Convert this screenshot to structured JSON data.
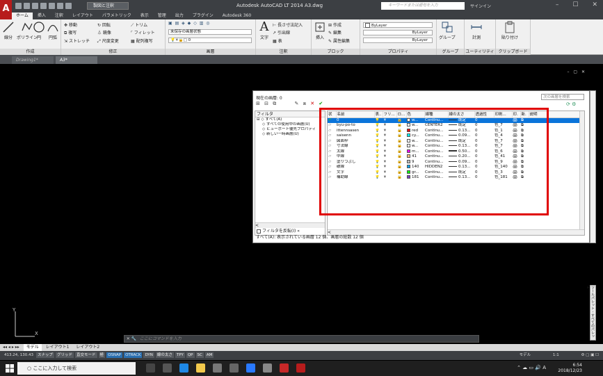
{
  "window": {
    "app_title": "Autodesk AutoCAD LT 2014   A3.dwg",
    "workspace": "製図と注釈",
    "search_placeholder": "キーワードまたは語句を入力",
    "signin": "サインイン",
    "filename": "A3.dwg"
  },
  "ribbon_tabs": [
    "ホーム",
    "挿入",
    "注釈",
    "レイアウト",
    "パラメトリック",
    "表示",
    "管理",
    "出力",
    "プラグイン",
    "Autodesk 360"
  ],
  "ribbon": {
    "groups": {
      "draw": "作成",
      "modify": "修正",
      "layer": "画層",
      "annotation": "注釈",
      "block": "ブロック",
      "properties": "プロパティ",
      "group": "グループ",
      "utility": "ユーティリティ",
      "clipboard": "クリップボード"
    },
    "draw_buttons": [
      "線分",
      "ポリライン",
      "円",
      "円弧"
    ],
    "modify_items": [
      "移動",
      "回転",
      "トリム",
      "複写",
      "鏡像",
      "フィレット",
      "ストレッチ",
      "尺度変更",
      "配列複写"
    ],
    "layer_state": "未保存の画層状態",
    "layer_current": "0",
    "text_button": "文字",
    "annotation_items": [
      "長さ寸法記入",
      "引出線",
      "表"
    ],
    "block_items": [
      "挿入",
      "作成",
      "編集",
      "属性編集"
    ],
    "bylayer_color": "ByLayer",
    "bylayer_linetype": "ByLayer",
    "bylayer_lineweight": "ByLayer",
    "group_button": "グループ",
    "measure_button": "計測",
    "paste_button": "貼り付け"
  },
  "file_tabs": [
    "Drawing1*",
    "A3*"
  ],
  "layer_manager": {
    "current_layer": "現在の画層: 0",
    "search_placeholder": "次の画層を検索",
    "filter_header": "フィルタ",
    "tree": [
      "すべて(A)",
      "すべての使用中の画層(U)",
      "ビューポート優先プロパティ",
      "新しい一時画層(U)"
    ],
    "invert_filter": "フィルタを反転(I)",
    "status": "すべて(A): 表示されている画層 12 個、画層の総数 12 個",
    "columns": [
      "状",
      "名前",
      "表..",
      "フリ...",
      "ロ...",
      "色",
      "線種",
      "線の太さ",
      "透過性",
      "印刷...",
      "印.",
      "新.",
      "説明"
    ],
    "rows": [
      {
        "name": "0",
        "color": "w...",
        "swatch": "#ffffff",
        "linetype": "Continu...",
        "lw": "既定",
        "trans": "0",
        "plot": "",
        "selected": true
      },
      {
        "name": "byu-po-to",
        "color": "w...",
        "swatch": "#ffffff",
        "linetype": "CENTER2",
        "lw": "既定",
        "trans": "0",
        "plot": "色_7",
        "selected": false
      },
      {
        "name": "ittennsasen",
        "color": "red",
        "swatch": "#ff0000",
        "linetype": "Continu...",
        "lw": "0.13...",
        "trans": "0",
        "plot": "色_1",
        "selected": false
      },
      {
        "name": "saisenn",
        "color": "cy...",
        "swatch": "#00ffff",
        "linetype": "Continu...",
        "lw": "0.09...",
        "trans": "0",
        "plot": "色_4",
        "selected": false
      },
      {
        "name": "図面枠",
        "color": "w...",
        "swatch": "#ffffff",
        "linetype": "Continu...",
        "lw": "既定",
        "trans": "0",
        "plot": "色_7",
        "selected": false
      },
      {
        "name": "寸法線",
        "color": "w...",
        "swatch": "#ffffff",
        "linetype": "Continu...",
        "lw": "0.13...",
        "trans": "0",
        "plot": "色_7",
        "selected": false
      },
      {
        "name": "太線",
        "color": "m...",
        "swatch": "#ff00ff",
        "linetype": "Continu...",
        "lw": "0.50...",
        "trans": "0",
        "plot": "色_6",
        "selected": false
      },
      {
        "name": "中線",
        "color": "41",
        "swatch": "#ffbf7f",
        "linetype": "Continu...",
        "lw": "0.20...",
        "trans": "0",
        "plot": "色_41",
        "selected": false
      },
      {
        "name": "塗りつぶし",
        "color": "9",
        "swatch": "#bebebe",
        "linetype": "Continu...",
        "lw": "0.09...",
        "trans": "0",
        "plot": "色_9",
        "selected": false
      },
      {
        "name": "破線",
        "color": "140",
        "swatch": "#00a5ff",
        "linetype": "HIDDEN2",
        "lw": "0.13...",
        "trans": "0",
        "plot": "色_140",
        "selected": false
      },
      {
        "name": "文字",
        "color": "gr...",
        "swatch": "#00ff00",
        "linetype": "Continu...",
        "lw": "既定",
        "trans": "0",
        "plot": "色_3",
        "selected": false
      },
      {
        "name": "補助線",
        "color": "181",
        "swatch": "#7f3fbf",
        "linetype": "Continu...",
        "lw": "0.13...",
        "trans": "0",
        "plot": "色_181",
        "selected": false
      }
    ]
  },
  "command_line": {
    "placeholder": "ここにコマンドを入力"
  },
  "layout_tabs": [
    "モデル",
    "レイアウト1",
    "レイアウト2"
  ],
  "status_bar": {
    "coords": "413.24, 130.43",
    "modes": [
      "スナップ",
      "グリッド",
      "直交モード",
      "極",
      "OSNAP",
      "OTRACK",
      "DYN",
      "線の太さ",
      "TPY",
      "QP",
      "SC",
      "AM"
    ],
    "model": "モデル",
    "scale": "1:1"
  },
  "taskbar": {
    "search_placeholder": "ここに入力して検索",
    "time": "6:54",
    "date": "2018/12/23",
    "ime": "A"
  },
  "side_palette": "ツールパレット - すべてのパレット"
}
